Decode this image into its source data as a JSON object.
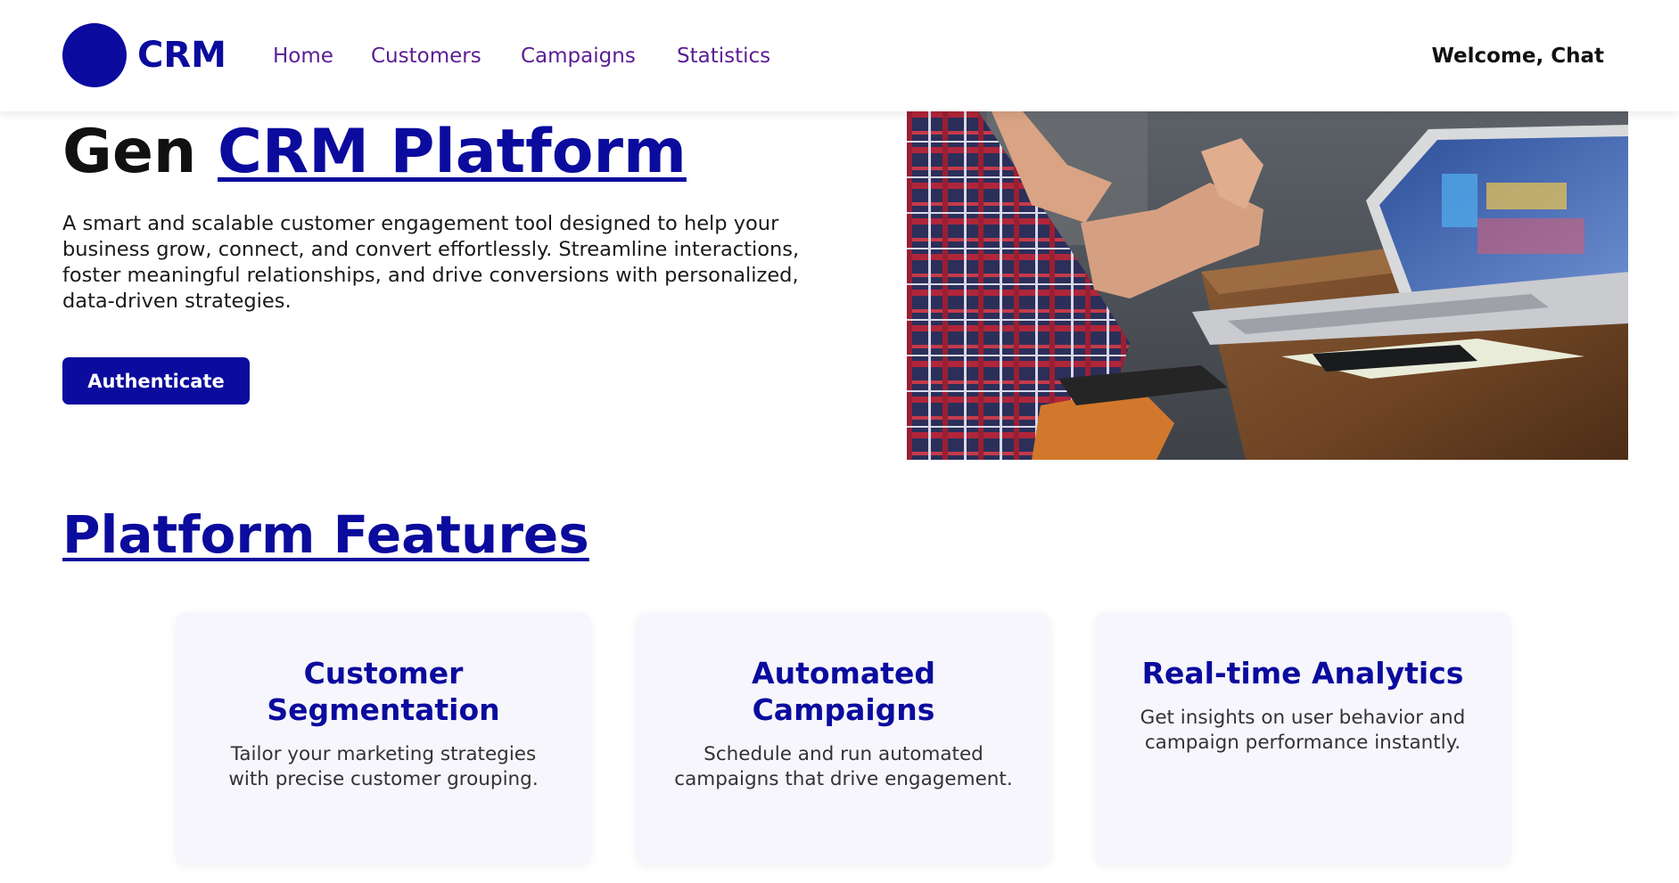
{
  "nav": {
    "logo_text": "CRM",
    "links": [
      {
        "label": "Home"
      },
      {
        "label": "Customers"
      },
      {
        "label": "Campaigns"
      },
      {
        "label": "Statistics"
      }
    ],
    "welcome": "Welcome, Chat"
  },
  "hero": {
    "title_prefix": "Gen",
    "title_link": "CRM Platform",
    "description": "A smart and scalable customer engagement tool designed to help your business grow, connect, and convert effortlessly. Streamline interactions, foster meaningful relationships, and drive conversions with personalized, data-driven strategies.",
    "button_label": "Authenticate"
  },
  "features": {
    "title": "Platform Features",
    "cards": [
      {
        "title": "Customer Segmentation",
        "description": "Tailor your marketing strategies with precise customer grouping."
      },
      {
        "title": "Automated Campaigns",
        "description": "Schedule and run automated campaigns that drive engagement."
      },
      {
        "title": "Real-time Analytics",
        "description": "Get insights on user behavior and campaign performance instantly."
      }
    ]
  },
  "colors": {
    "brand": "#0b0b9e",
    "nav_link": "#5a1d94",
    "card_bg": "#f6f6fc"
  }
}
